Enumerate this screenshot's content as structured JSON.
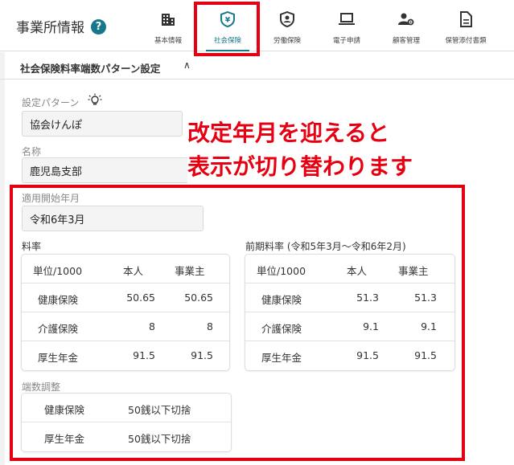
{
  "header": {
    "title": "事業所情報",
    "help": "?",
    "nav": [
      {
        "label": "基本情報",
        "icon": "building-icon"
      },
      {
        "label": "社会保険",
        "icon": "shield-yen-icon"
      },
      {
        "label": "労働保険",
        "icon": "user-shield-icon"
      },
      {
        "label": "電子申請",
        "icon": "laptop-icon"
      },
      {
        "label": "顧客管理",
        "icon": "user-gear-icon"
      },
      {
        "label": "保管添付書類",
        "icon": "document-icon"
      }
    ]
  },
  "section": {
    "title": "社会保険料率端数パターン設定",
    "chevron": "∧"
  },
  "form": {
    "pattern_label": "設定パターン",
    "pattern_value": "協会けんぽ",
    "name_label": "名称",
    "name_value": "鹿児島支部",
    "start_label": "適用開始年月",
    "start_value": "令和6年3月"
  },
  "callout": {
    "line1": "改定年月を迎えると",
    "line2": "表示が切り替わります"
  },
  "rates": {
    "label": "料率",
    "headers": [
      "単位/1000",
      "本人",
      "事業主"
    ],
    "rows": [
      [
        "健康保険",
        "50.65",
        "50.65"
      ],
      [
        "介護保険",
        "8",
        "8"
      ],
      [
        "厚生年金",
        "91.5",
        "91.5"
      ]
    ]
  },
  "prev_rates": {
    "label": "前期料率 (令和5年3月～令和6年2月)",
    "headers": [
      "単位/1000",
      "本人",
      "事業主"
    ],
    "rows": [
      [
        "健康保険",
        "51.3",
        "51.3"
      ],
      [
        "介護保険",
        "9.1",
        "9.1"
      ],
      [
        "厚生年金",
        "91.5",
        "91.5"
      ]
    ]
  },
  "rounding": {
    "label": "端数調整",
    "rows": [
      [
        "健康保険",
        "50銭以下切捨"
      ],
      [
        "厚生年金",
        "50銭以下切捨"
      ]
    ]
  },
  "colors": {
    "accent": "#16788a",
    "highlight": "#e60012"
  }
}
